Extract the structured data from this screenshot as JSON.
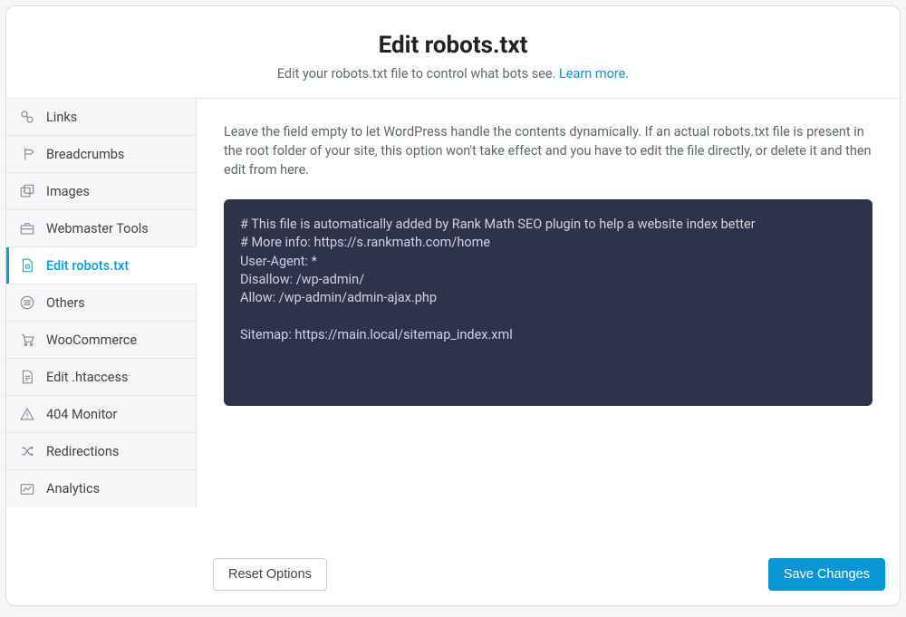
{
  "header": {
    "title": "Edit robots.txt",
    "subtitle_pre": "Edit your robots.txt file to control what bots see. ",
    "learn_more": "Learn more",
    "subtitle_post": "."
  },
  "sidebar": {
    "items": [
      {
        "label": "Links"
      },
      {
        "label": "Breadcrumbs"
      },
      {
        "label": "Images"
      },
      {
        "label": "Webmaster Tools"
      },
      {
        "label": "Edit robots.txt"
      },
      {
        "label": "Others"
      },
      {
        "label": "WooCommerce"
      },
      {
        "label": "Edit .htaccess"
      },
      {
        "label": "404 Monitor"
      },
      {
        "label": "Redirections"
      },
      {
        "label": "Analytics"
      }
    ],
    "active_index": 4
  },
  "main": {
    "description": "Leave the field empty to let WordPress handle the contents dynamically. If an actual robots.txt file is present in the root folder of your site, this option won't take effect and you have to edit the file directly, or delete it and then edit from here.",
    "editor_content": "# This file is automatically added by Rank Math SEO plugin to help a website index better\n# More info: https://s.rankmath.com/home\nUser-Agent: *\nDisallow: /wp-admin/\nAllow: /wp-admin/admin-ajax.php\n\nSitemap: https://main.local/sitemap_index.xml"
  },
  "footer": {
    "reset_label": "Reset Options",
    "save_label": "Save Changes"
  },
  "colors": {
    "accent": "#069de3",
    "editor_bg": "#2f3349",
    "primary_btn": "#0a96d6"
  }
}
